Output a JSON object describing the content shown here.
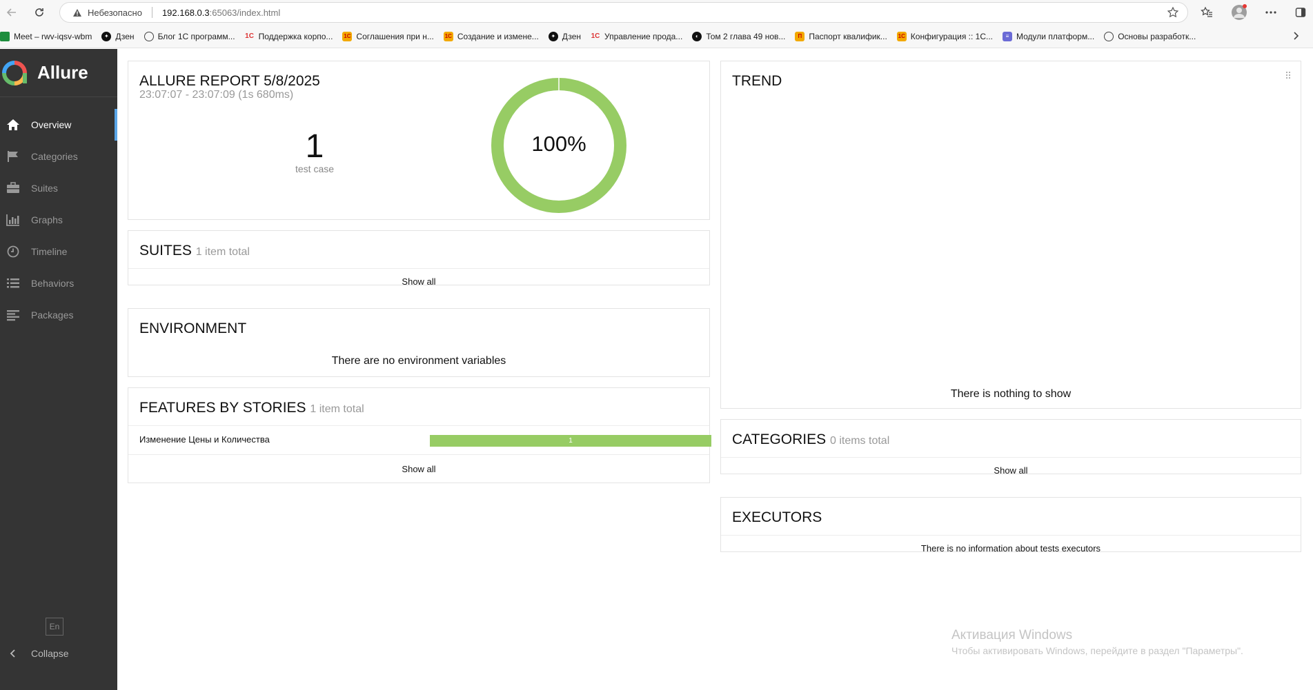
{
  "browser": {
    "security_label": "Небезопасно",
    "url_host": "192.168.0.3",
    "url_rest": ":65063/index.html",
    "bookmarks": [
      {
        "label": "Meet – rwv-iqsv-wbm",
        "icon": "meet-icon"
      },
      {
        "label": "Дзен",
        "icon": "dzen-icon"
      },
      {
        "label": "Блог 1С программ...",
        "icon": "globe-icon"
      },
      {
        "label": "Поддержка корпо...",
        "icon": "1c-icon"
      },
      {
        "label": "Соглашения при н...",
        "icon": "1c-orange-icon"
      },
      {
        "label": "Создание и измене...",
        "icon": "1c-orange-icon"
      },
      {
        "label": "Дзен",
        "icon": "dzen-icon"
      },
      {
        "label": "Управление прода...",
        "icon": "1c-icon"
      },
      {
        "label": "Том 2 глава 49 нов...",
        "icon": "book-icon"
      },
      {
        "label": "Паспорт квалифик...",
        "icon": "passport-icon"
      },
      {
        "label": "Конфигурация :: 1С...",
        "icon": "1c-orange-icon"
      },
      {
        "label": "Модули платформ...",
        "icon": "doc-icon"
      },
      {
        "label": "Основы разработк...",
        "icon": "globe-icon"
      }
    ]
  },
  "sidebar": {
    "brand": "Allure",
    "items": [
      {
        "label": "Overview",
        "icon": "home-icon",
        "active": true
      },
      {
        "label": "Categories",
        "icon": "flag-icon",
        "active": false
      },
      {
        "label": "Suites",
        "icon": "briefcase-icon",
        "active": false
      },
      {
        "label": "Graphs",
        "icon": "bar-chart-icon",
        "active": false
      },
      {
        "label": "Timeline",
        "icon": "clock-icon",
        "active": false
      },
      {
        "label": "Behaviors",
        "icon": "list-icon",
        "active": false
      },
      {
        "label": "Packages",
        "icon": "align-left-icon",
        "active": false
      }
    ],
    "language": "En",
    "collapse_label": "Collapse"
  },
  "report": {
    "title": "ALLURE REPORT 5/8/2025",
    "time": "23:07:07 - 23:07:09 (1s 680ms)",
    "count": "1",
    "count_label": "test case",
    "percent": "100%",
    "passed_fraction": 1.0,
    "pass_color": "#97cc64"
  },
  "suites": {
    "title": "SUITES",
    "subtitle": "1 item total",
    "show_all": "Show all"
  },
  "environment": {
    "title": "ENVIRONMENT",
    "empty": "There are no environment variables"
  },
  "features": {
    "title": "FEATURES BY STORIES",
    "subtitle": "1 item total",
    "rows": [
      {
        "name": "Изменение Цены и Количества",
        "value": "1"
      }
    ],
    "show_all": "Show all"
  },
  "trend": {
    "title": "TREND",
    "empty": "There is nothing to show"
  },
  "categories": {
    "title": "CATEGORIES",
    "subtitle": "0 items total",
    "show_all": "Show all"
  },
  "executors": {
    "title": "EXECUTORS",
    "empty": "There is no information about tests executors"
  },
  "watermark": {
    "line1": "Активация Windows",
    "line2": "Чтобы активировать Windows, перейдите в раздел \"Параметры\"."
  }
}
